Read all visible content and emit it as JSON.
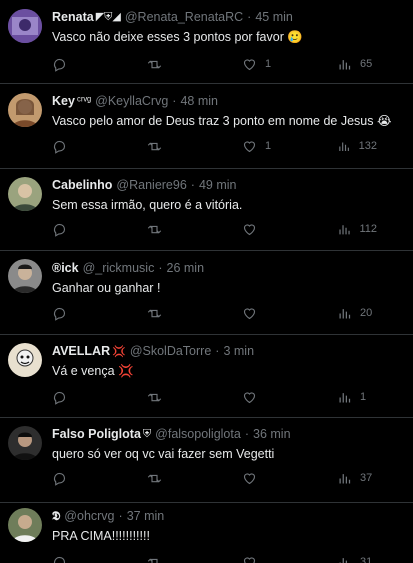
{
  "tweets": [
    {
      "name": "Renata",
      "badge": "◤⛨◢",
      "handle": "@Renata_RenataRC",
      "time": "45 min",
      "text": "Vasco não deixe esses 3 pontos por favor 🥲",
      "replies": "",
      "retweets": "",
      "likes": "1",
      "views": "65",
      "avatar_color": "#6b4fa0"
    },
    {
      "name": "Key",
      "badge": "ᶜʳᵛᵍ",
      "handle": "@KeyllaCrvg",
      "time": "48 min",
      "text": "Vasco pelo amor de Deus traz 3 ponto em nome de Jesus 😭",
      "replies": "",
      "retweets": "",
      "likes": "1",
      "views": "132",
      "avatar_color": "#a86a3c"
    },
    {
      "name": "Cabelinho",
      "badge": "",
      "handle": "@Raniere96",
      "time": "49 min",
      "text": "Sem essa irmão, quero é a vitória.",
      "replies": "",
      "retweets": "",
      "likes": "",
      "views": "112",
      "avatar_color": "#8a8f72"
    },
    {
      "name": "®ick",
      "badge": "",
      "handle": "@_rickmusic",
      "time": "26 min",
      "text": "Ganhar ou ganhar !",
      "replies": "",
      "retweets": "",
      "likes": "",
      "views": "20",
      "avatar_color": "#6e6e6e"
    },
    {
      "name": "AVELLAR",
      "badge": "💢",
      "handle": "@SkolDaTorre",
      "time": "3 min",
      "text": "Vá e vença 💢",
      "replies": "",
      "retweets": "",
      "likes": "",
      "views": "1",
      "avatar_color": "#d9c9a8"
    },
    {
      "name": "Falso Poliglota",
      "badge": "⛨",
      "handle": "@falsopoliglota",
      "time": "36 min",
      "text": "quero só ver oq vc vai fazer sem Vegetti",
      "replies": "",
      "retweets": "",
      "likes": "",
      "views": "37",
      "avatar_color": "#3a3a3a"
    },
    {
      "name": "𝕯",
      "badge": "",
      "handle": "@ohcrvg",
      "time": "37 min",
      "text": "PRA CIMA!!!!!!!!!!!",
      "replies": "",
      "retweets": "",
      "likes": "",
      "views": "31",
      "avatar_color": "#5a6a4a"
    }
  ],
  "icons": {
    "reply": "reply-icon",
    "retweet": "retweet-icon",
    "like": "like-icon",
    "views": "views-icon"
  }
}
